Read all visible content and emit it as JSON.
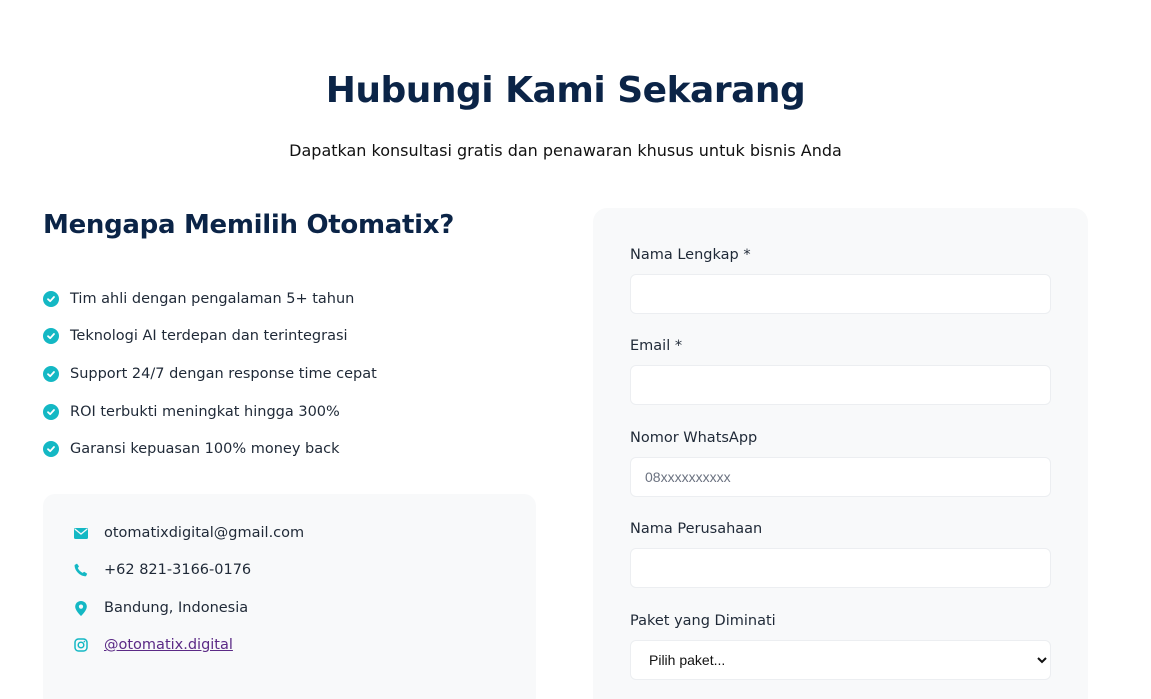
{
  "header": {
    "title": "Hubungi Kami Sekarang",
    "subtitle": "Dapatkan konsultasi gratis dan penawaran khusus untuk bisnis Anda"
  },
  "why": {
    "title": "Mengapa Memilih Otomatix?",
    "benefits": [
      "Tim ahli dengan pengalaman 5+ tahun",
      "Teknologi AI terdepan dan terintegrasi",
      "Support 24/7 dengan response time cepat",
      "ROI terbukti meningkat hingga 300%",
      "Garansi kepuasan 100% money back"
    ]
  },
  "contact": {
    "email": "otomatixdigital@gmail.com",
    "phone": "+62 821-3166-0176",
    "location": "Bandung, Indonesia",
    "instagram": "@otomatix.digital"
  },
  "form": {
    "name_label": "Nama Lengkap *",
    "email_label": "Email *",
    "whatsapp_label": "Nomor WhatsApp",
    "whatsapp_placeholder": "08xxxxxxxxxx",
    "company_label": "Nama Perusahaan",
    "package_label": "Paket yang Diminati",
    "package_selected": "Pilih paket..."
  },
  "colors": {
    "accent": "#14b8c4",
    "heading": "#0b2447",
    "card_bg": "#f8f9fa",
    "link": "#5b2a86"
  }
}
